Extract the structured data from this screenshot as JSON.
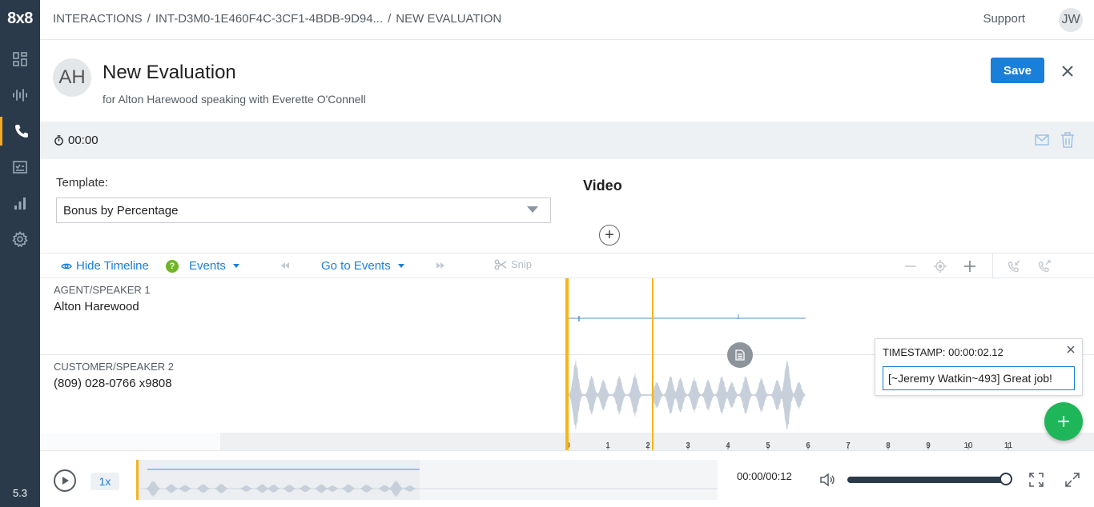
{
  "app": {
    "logo": "8x8",
    "version": "5.3",
    "accent_color": "#f5a623",
    "primary_color": "#1a7fd8",
    "nav_items": [
      "dashboard-icon",
      "waveform-icon",
      "phone-icon",
      "checklist-icon",
      "bar-chart-icon",
      "gear-icon"
    ],
    "active_nav": "phone-icon"
  },
  "topbar": {
    "breadcrumbs": [
      "INTERACTIONS",
      "INT-D3M0-1E460F4C-3CF1-4BDB-9D94...",
      "NEW EVALUATION"
    ],
    "separator": "/",
    "support": "Support",
    "user_initials": "JW"
  },
  "header": {
    "avatar_initials": "AH",
    "title": "New Evaluation",
    "subtitle": "for Alton Harewood speaking with Everette O'Connell",
    "save_label": "Save"
  },
  "timer": {
    "value": "00:00"
  },
  "template": {
    "label": "Template:",
    "selected": "Bonus by Percentage"
  },
  "video": {
    "title": "Video",
    "add_symbol": "+"
  },
  "toolbar": {
    "hide_timeline": "Hide Timeline",
    "events": "Events",
    "help": "?",
    "go_to_events": "Go to Events",
    "snip": "Snip"
  },
  "speakers": [
    {
      "role": "AGENT/SPEAKER 1",
      "name": "Alton Harewood"
    },
    {
      "role": "CUSTOMER/SPEAKER 2",
      "name": "(809) 028-0766 x9808"
    }
  ],
  "timeline": {
    "ticks": [
      "0",
      "1",
      "2",
      "3",
      "4",
      "5",
      "6",
      "7",
      "8",
      "9",
      "10",
      "11"
    ],
    "playhead_seconds": 2.12,
    "duration_seconds": 6
  },
  "popup": {
    "title": "TIMESTAMP: 00:00:02.12",
    "comment": "[~Jeremy Watkin~493] Great job!"
  },
  "player": {
    "speed": "1x",
    "time": "00:00/00:12",
    "volume": 1.0
  }
}
